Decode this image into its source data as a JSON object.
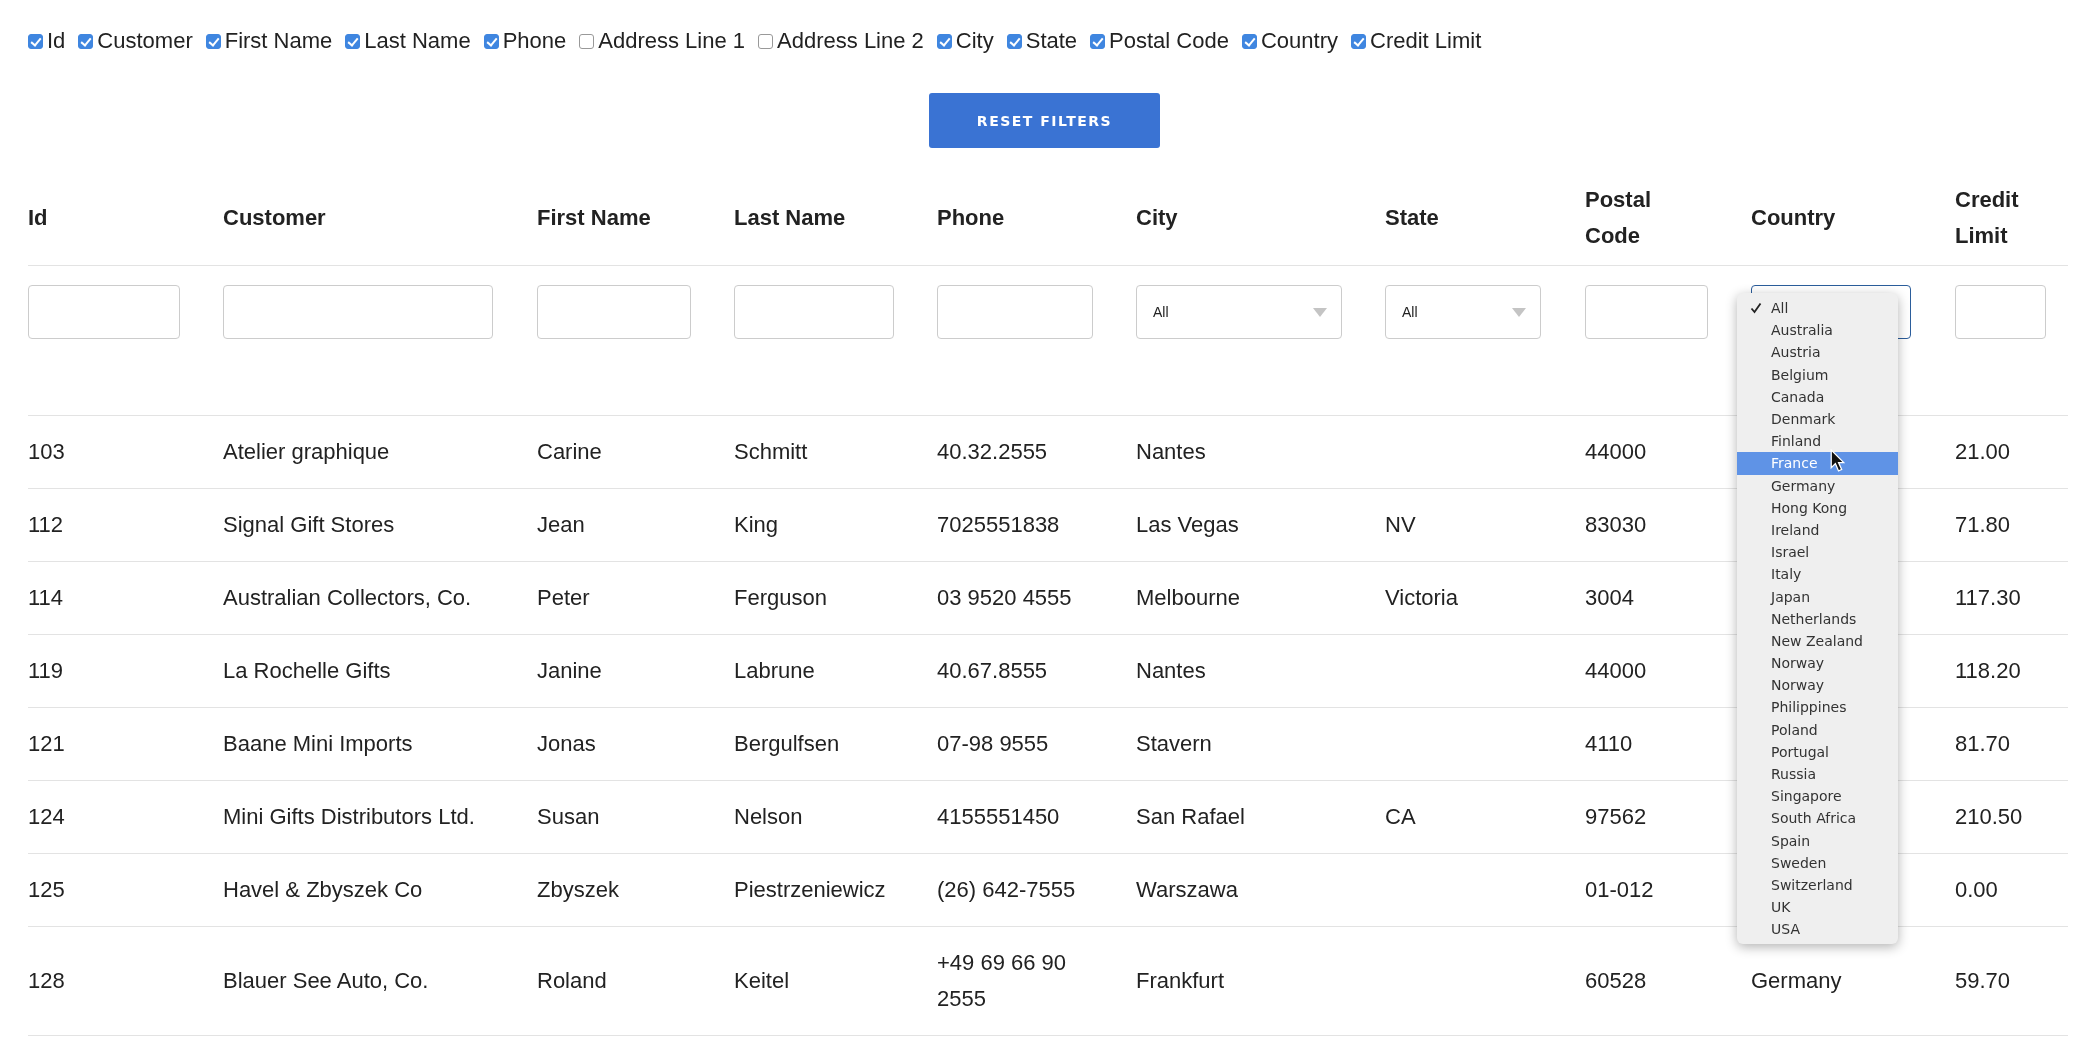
{
  "column_toggles": [
    {
      "label": "Id",
      "checked": true
    },
    {
      "label": "Customer",
      "checked": true
    },
    {
      "label": "First Name",
      "checked": true
    },
    {
      "label": "Last Name",
      "checked": true
    },
    {
      "label": "Phone",
      "checked": true
    },
    {
      "label": "Address Line 1",
      "checked": false
    },
    {
      "label": "Address Line 2",
      "checked": false
    },
    {
      "label": "City",
      "checked": true
    },
    {
      "label": "State",
      "checked": true
    },
    {
      "label": "Postal Code",
      "checked": true
    },
    {
      "label": "Country",
      "checked": true
    },
    {
      "label": "Credit Limit",
      "checked": true
    }
  ],
  "reset_button": "RESET FILTERS",
  "table": {
    "columns": [
      {
        "label": "Id",
        "filter": {
          "kind": "text"
        }
      },
      {
        "label": "Customer",
        "filter": {
          "kind": "text"
        }
      },
      {
        "label": "First Name",
        "filter": {
          "kind": "text"
        }
      },
      {
        "label": "Last Name",
        "filter": {
          "kind": "text"
        }
      },
      {
        "label": "Phone",
        "filter": {
          "kind": "text"
        }
      },
      {
        "label": "City",
        "filter": {
          "kind": "select",
          "value": "All"
        }
      },
      {
        "label": "State",
        "filter": {
          "kind": "select",
          "value": "All"
        }
      },
      {
        "label": "Postal Code",
        "filter": {
          "kind": "text"
        }
      },
      {
        "label": "Country",
        "filter": {
          "kind": "open-select",
          "options": [
            {
              "label": "All",
              "selected": true,
              "highlighted": false
            },
            {
              "label": "Australia",
              "selected": false,
              "highlighted": false
            },
            {
              "label": "Austria",
              "selected": false,
              "highlighted": false
            },
            {
              "label": "Belgium",
              "selected": false,
              "highlighted": false
            },
            {
              "label": "Canada",
              "selected": false,
              "highlighted": false
            },
            {
              "label": "Denmark",
              "selected": false,
              "highlighted": false
            },
            {
              "label": "Finland",
              "selected": false,
              "highlighted": false
            },
            {
              "label": "France",
              "selected": false,
              "highlighted": true
            },
            {
              "label": "Germany",
              "selected": false,
              "highlighted": false
            },
            {
              "label": "Hong Kong",
              "selected": false,
              "highlighted": false
            },
            {
              "label": "Ireland",
              "selected": false,
              "highlighted": false
            },
            {
              "label": "Israel",
              "selected": false,
              "highlighted": false
            },
            {
              "label": "Italy",
              "selected": false,
              "highlighted": false
            },
            {
              "label": "Japan",
              "selected": false,
              "highlighted": false
            },
            {
              "label": "Netherlands",
              "selected": false,
              "highlighted": false
            },
            {
              "label": "New Zealand",
              "selected": false,
              "highlighted": false
            },
            {
              "label": "Norway",
              "selected": false,
              "highlighted": false
            },
            {
              "label": "Norway",
              "selected": false,
              "highlighted": false
            },
            {
              "label": "Philippines",
              "selected": false,
              "highlighted": false
            },
            {
              "label": "Poland",
              "selected": false,
              "highlighted": false
            },
            {
              "label": "Portugal",
              "selected": false,
              "highlighted": false
            },
            {
              "label": "Russia",
              "selected": false,
              "highlighted": false
            },
            {
              "label": "Singapore",
              "selected": false,
              "highlighted": false
            },
            {
              "label": "South Africa",
              "selected": false,
              "highlighted": false
            },
            {
              "label": "Spain",
              "selected": false,
              "highlighted": false
            },
            {
              "label": "Sweden",
              "selected": false,
              "highlighted": false
            },
            {
              "label": "Switzerland",
              "selected": false,
              "highlighted": false
            },
            {
              "label": "UK",
              "selected": false,
              "highlighted": false
            },
            {
              "label": "USA",
              "selected": false,
              "highlighted": false
            }
          ]
        }
      },
      {
        "label": "Credit Limit",
        "filter": {
          "kind": "text"
        }
      }
    ],
    "rows": [
      [
        "103",
        "Atelier graphique",
        "Carine",
        "Schmitt",
        "40.32.2555",
        "Nantes",
        "",
        "44000",
        "",
        "21.00"
      ],
      [
        "112",
        "Signal Gift Stores",
        "Jean",
        "King",
        "7025551838",
        "Las Vegas",
        "NV",
        "83030",
        "",
        "71.80"
      ],
      [
        "114",
        "Australian Collectors, Co.",
        "Peter",
        "Ferguson",
        "03 9520 4555",
        "Melbourne",
        "Victoria",
        "3004",
        "",
        "117.30"
      ],
      [
        "119",
        "La Rochelle Gifts",
        "Janine",
        "Labrune",
        "40.67.8555",
        "Nantes",
        "",
        "44000",
        "",
        "118.20"
      ],
      [
        "121",
        "Baane Mini Imports",
        "Jonas",
        "Bergulfsen",
        "07-98 9555",
        "Stavern",
        "",
        "4110",
        "",
        "81.70"
      ],
      [
        "124",
        "Mini Gifts Distributors Ltd.",
        "Susan",
        "Nelson",
        "4155551450",
        "San Rafael",
        "CA",
        "97562",
        "",
        "210.50"
      ],
      [
        "125",
        "Havel & Zbyszek Co",
        "Zbyszek",
        "Piestrzeniewicz",
        "(26) 642-7555",
        "Warszawa",
        "",
        "01-012",
        "",
        "0.00"
      ],
      [
        "128",
        "Blauer See Auto, Co.",
        "Roland",
        "Keitel",
        "+49 69 66 90 2555",
        "Frankfurt",
        "",
        "60528",
        "Germany",
        "59.70"
      ]
    ]
  }
}
